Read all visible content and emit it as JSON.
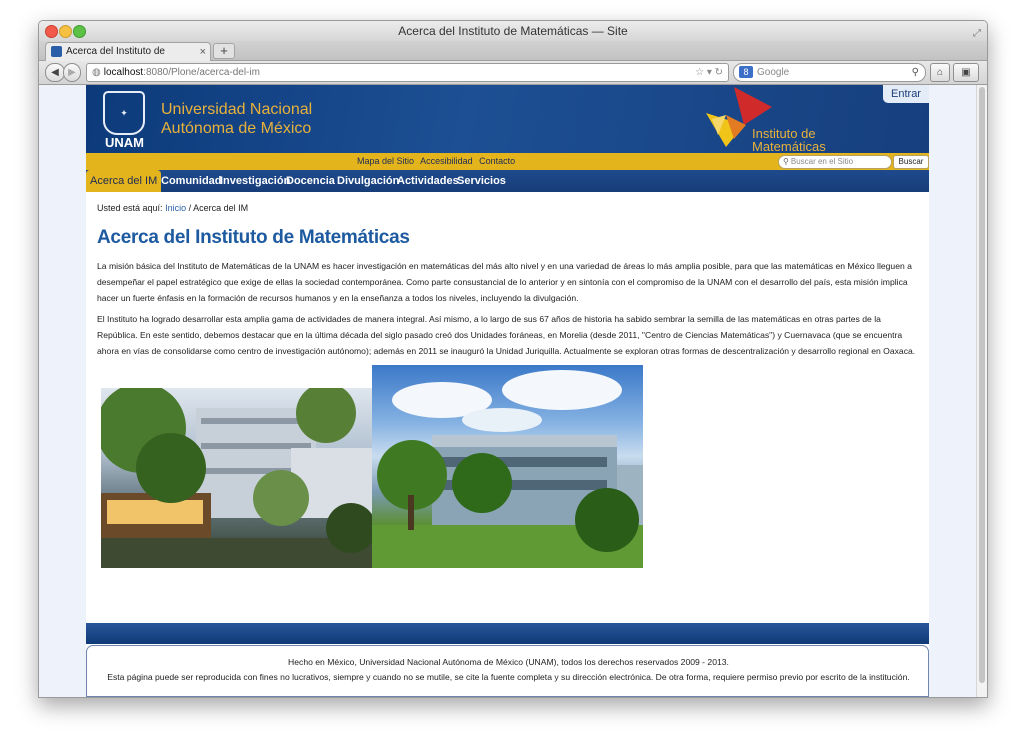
{
  "window": {
    "title": "Acerca del Instituto de Matemáticas — Site"
  },
  "tab": {
    "label": "Acerca del Instituto de Matemát...",
    "close": "×",
    "new_tab": "+"
  },
  "toolbar": {
    "back": "◀",
    "forward": "▶",
    "url_host": "localhost",
    "url_rest": ":8080/Plone/acerca-del-im",
    "url_controls": "☆ ▾ ↻",
    "search_placeholder": "Google",
    "search_engine": "8",
    "home_icon": "⌂",
    "bookmark_icon": "▣"
  },
  "header": {
    "unam_label": "UNAM",
    "university_line1": "Universidad Nacional",
    "university_line2": "Autónoma de México",
    "institute_line1": "Instituto de",
    "institute_line2": "Matemáticas",
    "login_button": "Entrar"
  },
  "utility_nav": {
    "items": [
      "Mapa del Sitio",
      "Accesibilidad",
      "Contacto"
    ],
    "search_placeholder": "Buscar en el Sitio",
    "search_button": "Buscar"
  },
  "main_nav": {
    "items": [
      "Acerca del IM",
      "Comunidad",
      "Investigación",
      "Docencia",
      "Divulgación",
      "Actividades",
      "Servicios"
    ]
  },
  "breadcrumb": {
    "prefix": "Usted está aquí:",
    "home": "Inicio",
    "separator": "/",
    "current": "Acerca del IM"
  },
  "content": {
    "title": "Acerca del Instituto de Matemáticas",
    "paragraph1": "La misión básica del Instituto de Matemáticas de la UNAM es hacer investigación en matemáticas del más alto nivel y en una variedad de áreas lo más amplia posible, para que las matemáticas en México lleguen a desempeñar el papel estratégico que exige de ellas la sociedad contemporánea. Como parte consustancial de lo anterior y en sintonía con el compromiso de la UNAM con el desarrollo del país, esta misión implica hacer un fuerte énfasis en la formación de recursos humanos y en la enseñanza a todos los niveles, incluyendo la divulgación.",
    "paragraph2": "El Instituto ha logrado desarrollar esta amplia gama de actividades de manera integral. Así mismo, a lo largo de sus 67 años de historia ha sabido sembrar la semilla de las matemáticas en otras partes de la República. En este sentido, debemos destacar que en la última década del siglo pasado creó dos Unidades foráneas, en Morelia (desde 2011, \"Centro de Ciencias Matemáticas\") y Cuernavaca (que se encuentra ahora en vías de consolidarse como centro de investigación autónomo); además en 2011 se inauguró la Unidad Juriquilla. Actualmente se exploran otras formas de descentralización y desarrollo regional en Oaxaca."
  },
  "footer": {
    "line1": "Hecho en México, Universidad Nacional Autónoma de México (UNAM), todos los derechos reservados 2009 - 2013.",
    "line2": "Esta página puede ser reproducida con fines no lucrativos, siempre y cuando no se mutile, se cite la fuente completa y su dirección electrónica. De otra forma, requiere permiso previo por escrito de la institución."
  },
  "colors": {
    "header_blue": "#1d4f94",
    "accent_gold": "#e4b41d",
    "title_blue": "#1d5aa0",
    "link_blue": "#2a5fa8"
  }
}
